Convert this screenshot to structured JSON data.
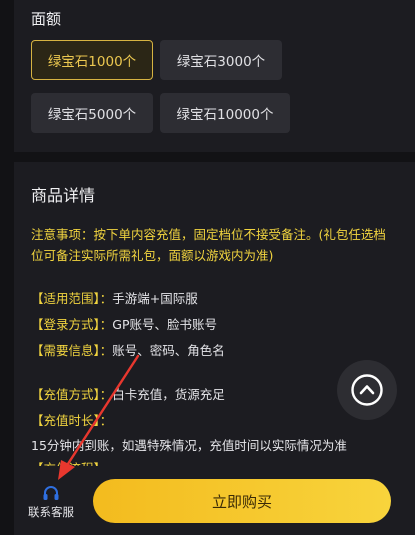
{
  "denomination": {
    "label": "面额",
    "options": [
      "绿宝石1000个",
      "绿宝石3000个",
      "绿宝石5000个",
      "绿宝石10000个"
    ],
    "selected": "绿宝石1000个"
  },
  "details": {
    "title": "商品详情",
    "notice": "注意事项：按下单内容充值，固定档位不接受备注。(礼包任选档位可备注实际所需礼包，面额以游戏内为准)",
    "scope_key": "【适用范围】：",
    "scope_value": "手游端+国际服",
    "login_key": "【登录方式】：",
    "login_value": "GP账号、脸书账号",
    "need_key": "【需要信息】：",
    "need_value": "账号、密码、角色名",
    "method_key": "【充值方式】：",
    "method_value": "白卡充值，货源充足",
    "duration_key": "【充值时长】：",
    "duration_value": "15分钟内到账，如遇特殊情况，充值时间以实际情况为准",
    "next_key": "【充值流程】"
  },
  "bottom_bar": {
    "customer_service_label": "联系客服",
    "buy_label": "立即购买"
  },
  "icons": {
    "scroll_top": "chevron-up-circle-icon",
    "customer_service": "headset-icon",
    "annotation": "red-arrow"
  },
  "colors": {
    "accent_yellow": "#f1d43f",
    "selected_border": "#d6b342",
    "buy_gradient_start": "#f3bb1e",
    "buy_gradient_end": "#f8d43c",
    "service_icon": "#2f6fe0",
    "annotation_arrow": "#e8372e"
  }
}
